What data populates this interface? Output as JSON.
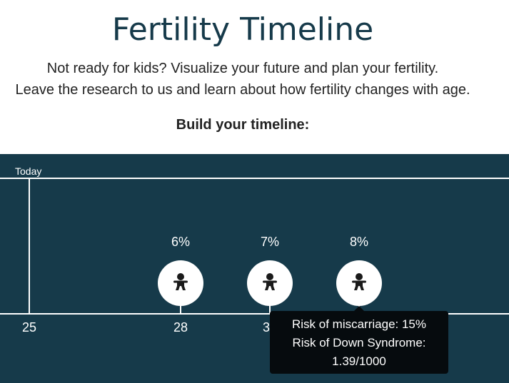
{
  "header": {
    "title": "Fertility Timeline",
    "subtitle_line1": "Not ready for kids? Visualize your future and plan your fertility.",
    "subtitle_line2": "Leave the research to us and learn about how fertility changes with age.",
    "build_label": "Build your timeline:"
  },
  "timeline": {
    "today_label": "Today",
    "ticks": [
      "25",
      "28",
      "30"
    ],
    "markers": [
      {
        "percent": "6%",
        "icon": "baby-icon"
      },
      {
        "percent": "7%",
        "icon": "baby-icon"
      },
      {
        "percent": "8%",
        "icon": "baby-icon"
      }
    ],
    "colors": {
      "panel": "#163a4a",
      "line": "#ffffff",
      "tooltip": "#060b0e"
    }
  },
  "tooltip": {
    "line1": "Risk of miscarriage: 15%",
    "line2": "Risk of Down Syndrome:",
    "line3": "1.39/1000"
  }
}
